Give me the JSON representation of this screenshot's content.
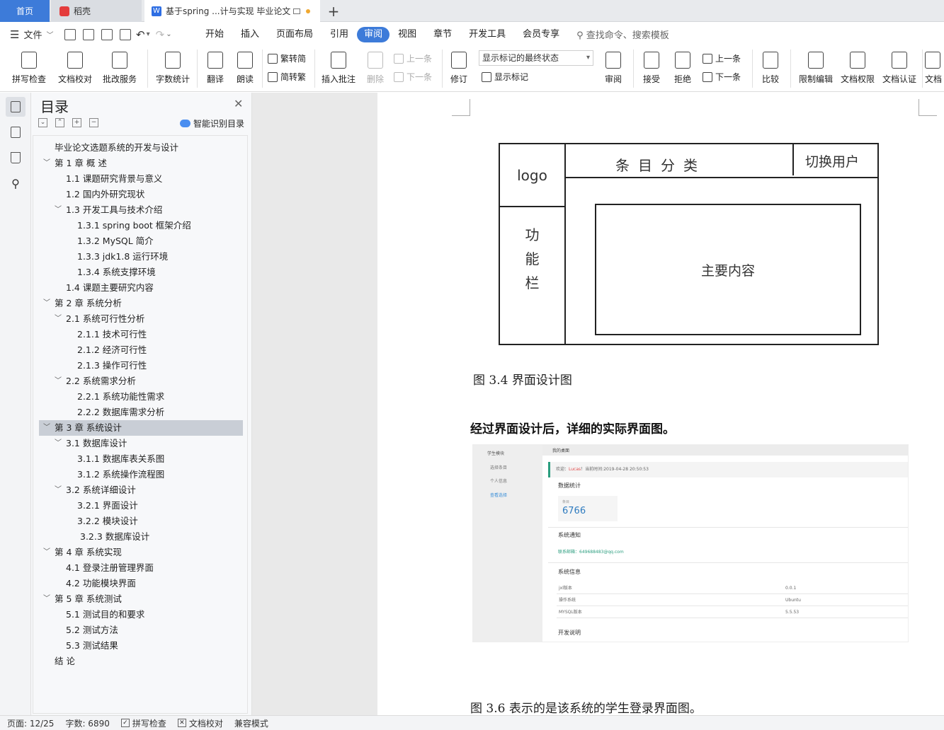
{
  "tabs": {
    "home": "首页",
    "daoke": "稻壳",
    "doc": "基于spring ...计与实现 毕业论文",
    "add": "+"
  },
  "menu": {
    "file": "文件",
    "tabs": [
      "开始",
      "插入",
      "页面布局",
      "引用",
      "审阅",
      "视图",
      "章节",
      "开发工具",
      "会员专享"
    ],
    "active_tab": "审阅",
    "search": "查找命令、搜索模板"
  },
  "ribbon": {
    "spell_check": "拼写检查",
    "doc_proof": "文档校对",
    "batch_service": "批改服务",
    "word_count": "字数统计",
    "translate": "翻译",
    "read_aloud": "朗读",
    "trad_simp": "繁转简",
    "simp_trad": "简转繁",
    "insert_comment": "插入批注",
    "delete": "删除",
    "prev": "上一条",
    "next": "下一条",
    "revise": "修订",
    "markup_state": "显示标记的最终状态",
    "show_markup": "显示标记",
    "review": "审阅",
    "accept": "接受",
    "reject": "拒绝",
    "prev2": "上一条",
    "next2": "下一条",
    "compare": "比较",
    "restrict_edit": "限制编辑",
    "doc_permission": "文档权限",
    "doc_cert": "文档认证",
    "doc_more": "文档"
  },
  "toc": {
    "title": "目录",
    "smart": "智能识别目录",
    "items": [
      {
        "text": "毕业论文选题系统的开发与设计",
        "level": 0,
        "arrow": ""
      },
      {
        "text": "第 1 章 概 述",
        "level": 0,
        "arrow": "v"
      },
      {
        "text": "1.1 课题研究背景与意义",
        "level": 1,
        "arrow": ""
      },
      {
        "text": "1.2 国内外研究现状",
        "level": 1,
        "arrow": ""
      },
      {
        "text": "1.3 开发工具与技术介绍",
        "level": 1,
        "arrow": "v"
      },
      {
        "text": "1.3.1 spring boot 框架介绍",
        "level": 2,
        "arrow": ""
      },
      {
        "text": "1.3.2 MySQL 简介",
        "level": 2,
        "arrow": ""
      },
      {
        "text": "1.3.3 jdk1.8 运行环境",
        "level": 2,
        "arrow": ""
      },
      {
        "text": "1.3.4 系统支撑环境",
        "level": 2,
        "arrow": ""
      },
      {
        "text": "1.4 课题主要研究内容",
        "level": 1,
        "arrow": ""
      },
      {
        "text": "第 2 章 系统分析",
        "level": 0,
        "arrow": "v"
      },
      {
        "text": "2.1 系统可行性分析",
        "level": 1,
        "arrow": "v"
      },
      {
        "text": "2.1.1 技术可行性",
        "level": 2,
        "arrow": ""
      },
      {
        "text": "2.1.2 经济可行性",
        "level": 2,
        "arrow": ""
      },
      {
        "text": "2.1.3 操作可行性",
        "level": 2,
        "arrow": ""
      },
      {
        "text": "2.2 系统需求分析",
        "level": 1,
        "arrow": "v"
      },
      {
        "text": "2.2.1 系统功能性需求",
        "level": 2,
        "arrow": ""
      },
      {
        "text": "2.2.2 数据库需求分析",
        "level": 2,
        "arrow": ""
      },
      {
        "text": "第 3 章 系统设计",
        "level": 0,
        "arrow": "v",
        "selected": true
      },
      {
        "text": "3.1 数据库设计",
        "level": 1,
        "arrow": "v"
      },
      {
        "text": "3.1.1 数据库表关系图",
        "level": 2,
        "arrow": ""
      },
      {
        "text": "3.1.2 系统操作流程图",
        "level": 2,
        "arrow": ""
      },
      {
        "text": "3.2 系统详细设计",
        "level": 1,
        "arrow": "v"
      },
      {
        "text": "3.2.1 界面设计",
        "level": 2,
        "arrow": ""
      },
      {
        "text": "3.2.2 模块设计",
        "level": 2,
        "arrow": ""
      },
      {
        "text": "3.2.3 数据库设计",
        "level": 3,
        "arrow": ""
      },
      {
        "text": "第 4 章 系统实现",
        "level": 0,
        "arrow": "v"
      },
      {
        "text": "4.1 登录注册管理界面",
        "level": 1,
        "arrow": ""
      },
      {
        "text": "4.2 功能模块界面",
        "level": 1,
        "arrow": ""
      },
      {
        "text": "第 5 章 系统测试",
        "level": 0,
        "arrow": "v"
      },
      {
        "text": "5.1 测试目的和要求",
        "level": 1,
        "arrow": ""
      },
      {
        "text": "5.2 测试方法",
        "level": 1,
        "arrow": ""
      },
      {
        "text": "5.3 测试结果",
        "level": 1,
        "arrow": ""
      },
      {
        "text": "结 论",
        "level": 0,
        "arrow": ""
      }
    ]
  },
  "doc": {
    "wireframe": {
      "logo": "logo",
      "category": "条目分类",
      "switch_user": "切换用户",
      "side": [
        "功",
        "能",
        "栏"
      ],
      "main": "主要内容"
    },
    "caption_34": "图 3.4 界面设计图",
    "para_bold": "经过界面设计后，详细的实际界面图。",
    "caption_36": "图 3.6 表示的是该系统的学生登录界面图。",
    "shot": {
      "side_title": "学生模块",
      "side_items": [
        "选择条目",
        "个人信息",
        "查看选择"
      ],
      "top_title": "我的桌面",
      "welcome": "欢迎：",
      "welcome_user": "Lucas",
      "welcome_time": "！当前时间:2019-04-28 20:50:53",
      "stats_title": "数据统计",
      "stat_label": "条目",
      "stat_value": "6766",
      "notice_title": "系统通知",
      "notice_text": "联系邮箱：649688483@qq.com",
      "info_title": "系统信息",
      "info_rows": [
        {
          "k": "jxl版本",
          "v": "0.0.1"
        },
        {
          "k": "操作系统",
          "v": "Ubuntu"
        },
        {
          "k": "MYSQL版本",
          "v": "5.5.53"
        }
      ],
      "dev_title": "开发说明"
    }
  },
  "status": {
    "page": "页面: 12/25",
    "words": "字数: 6890",
    "spell": "拼写检查",
    "proof": "文档校对",
    "compat": "兼容模式"
  }
}
